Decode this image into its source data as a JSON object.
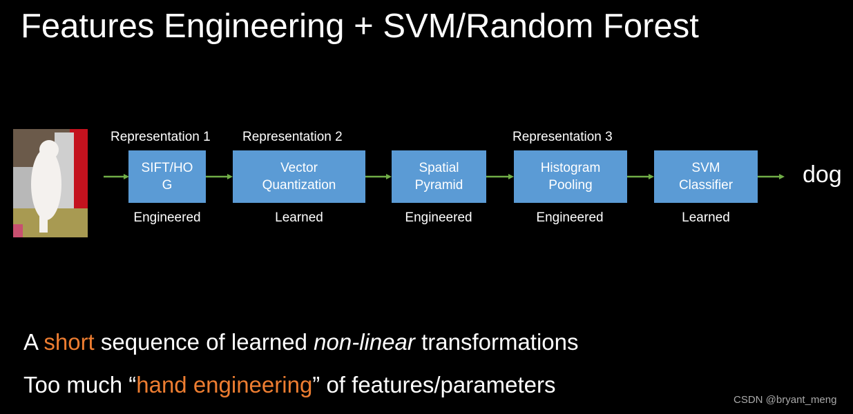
{
  "title": "Features Engineering + SVM/Random Forest",
  "input_image": {
    "alt": "dog standing on hind legs"
  },
  "pipeline": [
    {
      "label_line1": "SIFT/HO",
      "label_line2": "G",
      "type": "Engineered",
      "representation": "Representation 1"
    },
    {
      "label_line1": "Vector",
      "label_line2": "Quantization",
      "type": "Learned",
      "representation": "Representation 2"
    },
    {
      "label_line1": "Spatial",
      "label_line2": "Pyramid",
      "type": "Engineered",
      "representation": ""
    },
    {
      "label_line1": "Histogram",
      "label_line2": "Pooling",
      "type": "Engineered",
      "representation": "Representation 3"
    },
    {
      "label_line1": "SVM",
      "label_line2": "Classifier",
      "type": "Learned",
      "representation": ""
    }
  ],
  "output_label": "dog",
  "bullets": [
    {
      "pre": "A ",
      "highlight": "short",
      "mid": " sequence of learned ",
      "italic": "non-linear",
      "post": " transformations"
    },
    {
      "pre": "Too much “",
      "highlight": "hand engineering",
      "post": "” of features/parameters"
    }
  ],
  "watermark": "CSDN @bryant_meng",
  "colors": {
    "box": "#5b9bd5",
    "arrow": "#70ad47",
    "highlight": "#ed7d31",
    "background": "#000000"
  }
}
